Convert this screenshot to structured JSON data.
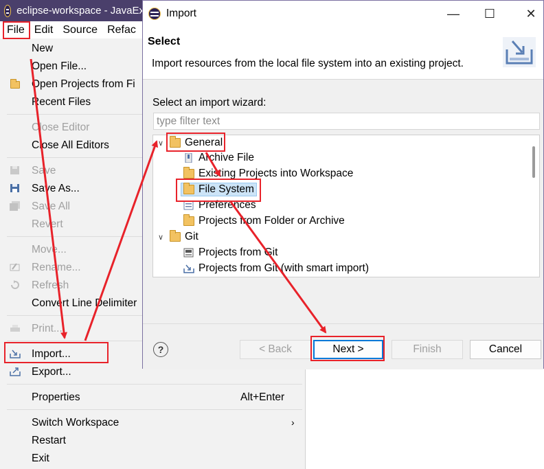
{
  "eclipse": {
    "title": "eclipse-workspace - JavaEx",
    "menus": [
      "File",
      "Edit",
      "Source",
      "Refac"
    ]
  },
  "file_menu": {
    "items": [
      {
        "label": "New",
        "enabled": true
      },
      {
        "label": "Open File...",
        "enabled": true
      },
      {
        "label": "Open Projects from Fi",
        "enabled": true,
        "icon": "folder-icon"
      },
      {
        "label": "Recent Files",
        "enabled": true
      },
      {
        "label": "Close Editor",
        "enabled": false
      },
      {
        "label": "Close All Editors",
        "enabled": true
      },
      {
        "label": "Save",
        "enabled": false,
        "icon": "save-icon"
      },
      {
        "label": "Save As...",
        "enabled": true,
        "icon": "save-as-icon"
      },
      {
        "label": "Save All",
        "enabled": false,
        "icon": "save-all-icon"
      },
      {
        "label": "Revert",
        "enabled": false
      },
      {
        "label": "Move...",
        "enabled": false
      },
      {
        "label": "Rename...",
        "enabled": false,
        "icon": "rename-icon"
      },
      {
        "label": "Refresh",
        "enabled": false,
        "icon": "refresh-icon"
      },
      {
        "label": "Convert Line Delimiter",
        "enabled": true
      },
      {
        "label": "Print...",
        "enabled": false,
        "icon": "print-icon"
      },
      {
        "label": "Import...",
        "enabled": true,
        "icon": "import-icon"
      },
      {
        "label": "Export...",
        "enabled": true,
        "icon": "export-icon"
      },
      {
        "label": "Properties",
        "enabled": true,
        "shortcut": "Alt+Enter"
      },
      {
        "label": "Switch Workspace",
        "enabled": true,
        "submenu": true
      },
      {
        "label": "Restart",
        "enabled": true
      },
      {
        "label": "Exit",
        "enabled": true
      }
    ]
  },
  "dialog": {
    "title": "Import",
    "header_title": "Select",
    "header_desc": "Import resources from the local file system into an existing project.",
    "wizard_label": "Select an import wizard:",
    "filter_placeholder": "type filter text",
    "tree": {
      "general": "General",
      "archive_file": "Archive File",
      "existing_projects": "Existing Projects into Workspace",
      "file_system": "File System",
      "preferences": "Preferences",
      "projects_folder": "Projects from Folder or Archive",
      "git": "Git",
      "projects_git": "Projects from Git",
      "projects_git_smart": "Projects from Git (with smart import)"
    },
    "buttons": {
      "help": "?",
      "back": "< Back",
      "next": "Next >",
      "finish": "Finish",
      "cancel": "Cancel"
    }
  },
  "colors": {
    "annotation": "#e8222a",
    "selection": "#cce4f7",
    "titlebar": "#4a3f6b"
  }
}
